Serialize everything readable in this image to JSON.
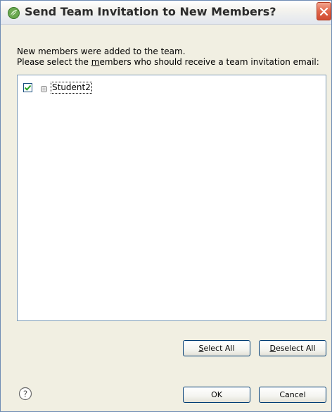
{
  "window": {
    "title": "Send Team Invitation to New Members?"
  },
  "content": {
    "message_line1": "New members were added to the team.",
    "message_line2_before": "Please select the ",
    "message_line2_underlined": "m",
    "message_line2_after": "embers who should receive a team invitation email:"
  },
  "members": [
    {
      "name": "Student2",
      "checked": true
    }
  ],
  "buttons": {
    "select_all_mnemonic": "S",
    "select_all_rest": "elect All",
    "deselect_all_mnemonic": "D",
    "deselect_all_rest": "eselect All",
    "ok": "OK",
    "cancel": "Cancel"
  },
  "icons": {
    "app": "leaf-icon",
    "close": "close-icon",
    "help": "help-icon",
    "member": "member-icon"
  },
  "colors": {
    "close_button": "#e0664a",
    "list_border": "#7f9db9",
    "button_border": "#003c74"
  }
}
